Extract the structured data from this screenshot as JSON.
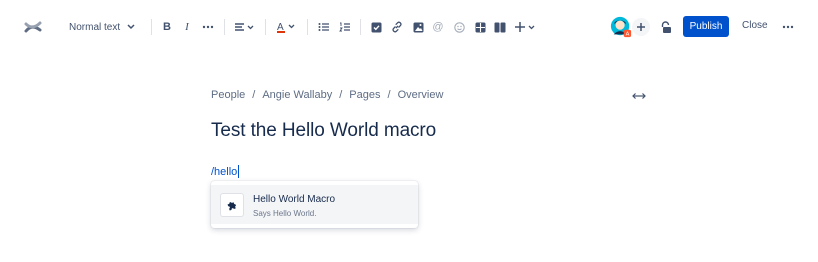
{
  "toolbar": {
    "text_style": "Normal text",
    "publish_label": "Publish",
    "close_label": "Close",
    "icons": [
      "confluence-logo-icon",
      "chevron-down-icon",
      "bold-icon",
      "italic-icon",
      "more-formatting-icon",
      "align-icon",
      "text-color-icon",
      "bullet-list-icon",
      "numbered-list-icon",
      "task-icon",
      "link-icon",
      "image-icon",
      "mention-icon",
      "emoji-icon",
      "table-icon",
      "layout-icon",
      "insert-icon",
      "avatar",
      "add-collaborator-icon",
      "restrictions-icon",
      "more-actions-icon"
    ]
  },
  "breadcrumb": [
    "People",
    "Angie Wallaby",
    "Pages",
    "Overview"
  ],
  "page": {
    "title": "Test the Hello World macro",
    "typed_text": "/hello"
  },
  "typeahead": {
    "items": [
      {
        "name": "Hello World Macro",
        "description": "Says Hello World.",
        "icon": "puzzle-icon"
      }
    ]
  },
  "colors": {
    "accent": "#0052cc",
    "text": "#172b4d",
    "muted": "#5e6c84"
  }
}
